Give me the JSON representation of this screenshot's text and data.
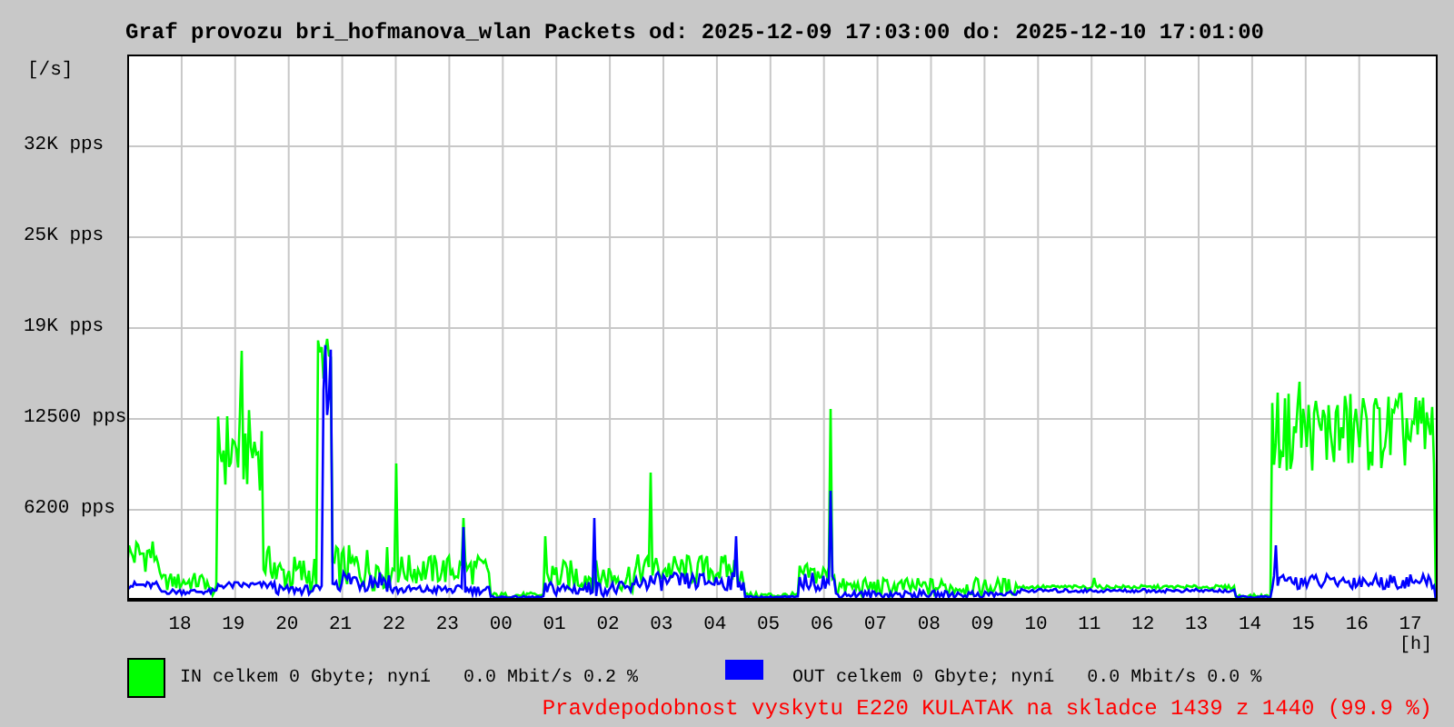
{
  "title": "Graf provozu bri_hofmanova_wlan Packets od: 2025-12-09 17:03:00 do: 2025-12-10 17:01:00",
  "chart": {
    "y_unit": "[/s]",
    "y_labels": [
      "32K pps",
      "25K pps",
      "19K pps",
      "12500 pps",
      "6200 pps"
    ],
    "x_labels": [
      "18",
      "19",
      "20",
      "21",
      "22",
      "23",
      "00",
      "01",
      "02",
      "03",
      "04",
      "05",
      "06",
      "07",
      "08",
      "09",
      "10",
      "11",
      "12",
      "13",
      "14",
      "15",
      "16",
      "17"
    ],
    "x_unit": "[h]"
  },
  "legend": [
    {
      "kind": "in",
      "color": "#00ff00",
      "text": "IN celkem 0 Gbyte; nyní   0.0 Mbit/s 0.2 %"
    },
    {
      "kind": "out",
      "color": "#0000ff",
      "text": "OUT celkem 0 Gbyte; nyní   0.0 Mbit/s 0.0 %"
    }
  ],
  "footer": "Pravdepodobnost vyskytu E220 KULATAK na skladce 1439 z 1440 (99.9 %)"
}
